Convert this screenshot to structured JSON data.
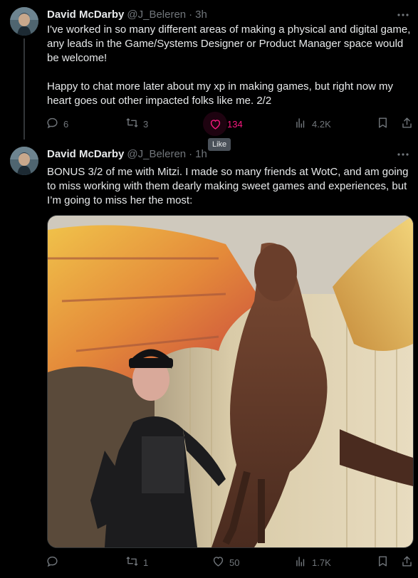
{
  "tweets": [
    {
      "name": "David McDarby",
      "handle": "@J_Beleren",
      "separator": "·",
      "time": "3h",
      "text": "I've worked in so many different areas of making a physical and digital game, any leads in the Game/Systems Designer or Product Manager space would be welcome!\n\nHappy to chat more later about my xp in making games, but right now my heart goes out other impacted folks like me. 2/2",
      "replies": "6",
      "reposts": "3",
      "likes": "134",
      "views": "4.2K",
      "like_tooltip": "Like"
    },
    {
      "name": "David McDarby",
      "handle": "@J_Beleren",
      "separator": "·",
      "time": "1h",
      "text": "BONUS 3/2 of me with Mitzi. I made so many friends at WotC, and am going to miss working with them dearly making sweet games and experiences, but I’m going to miss her the most:",
      "replies": "",
      "reposts": "1",
      "likes": "50",
      "views": "1.7K"
    }
  ],
  "colors": {
    "background": "#000000",
    "text": "#e7e9ea",
    "muted": "#71767b",
    "like_accent": "#f91880"
  },
  "icons": [
    "more-icon",
    "reply-icon",
    "repost-icon",
    "like-icon",
    "views-icon",
    "bookmark-icon",
    "share-icon"
  ]
}
